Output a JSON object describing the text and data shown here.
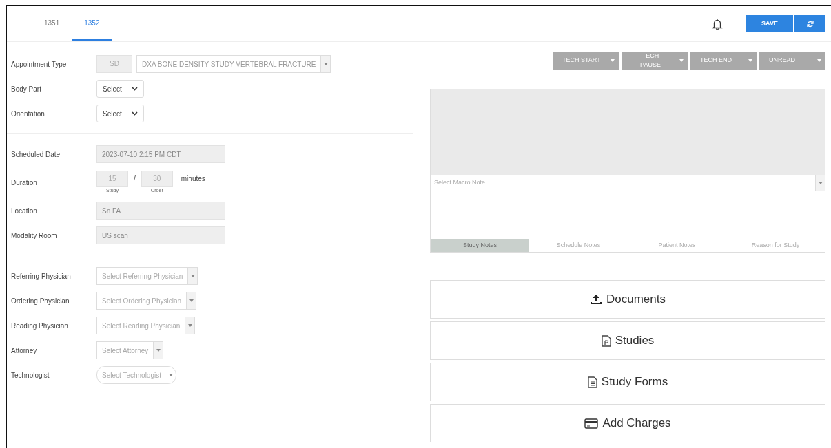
{
  "tabs": [
    {
      "label": "1351",
      "selected": false
    },
    {
      "label": "1352",
      "selected": true
    }
  ],
  "header": {
    "save_button": "SAVE"
  },
  "fields_top": [
    {
      "kind": "code_combo",
      "label": "Appointment Type",
      "code": "SD",
      "value": "DXA BONE DENSITY STUDY VERTEBRAL FRACTURE"
    },
    {
      "kind": "select",
      "label": "Body Part",
      "value": "Select"
    },
    {
      "kind": "select",
      "label": "Orientation",
      "value": "Select"
    }
  ],
  "fields_schedule": [
    {
      "kind": "text",
      "label": "Scheduled Date",
      "value": "2023-07-10 2:15 PM CDT"
    },
    {
      "kind": "duration",
      "label": "Duration",
      "study": "15",
      "study_caption": "Study",
      "separator": "/",
      "order": "30",
      "order_caption": "Order",
      "unit": "minutes"
    },
    {
      "kind": "text",
      "label": "Location",
      "value": "Sn FA"
    },
    {
      "kind": "text",
      "label": "Modality Room",
      "value": "US scan"
    }
  ],
  "fields_people": [
    {
      "kind": "combo",
      "label": "Referring Physician",
      "placeholder": "Select Referring Physician"
    },
    {
      "kind": "combo",
      "label": "Ordering Physician",
      "placeholder": "Select Ordering Physician"
    },
    {
      "kind": "combo",
      "label": "Reading Physician",
      "placeholder": "Select Reading Physician"
    },
    {
      "kind": "combo",
      "label": "Attorney",
      "placeholder": "Select Attorney"
    },
    {
      "kind": "pill",
      "label": "Technologist",
      "placeholder": "Select Technologist"
    }
  ],
  "status_buttons": [
    "TECH START",
    "TECH PAUSE",
    "TECH END",
    "UNREAD"
  ],
  "notes": {
    "macro_placeholder": "Select Macro Note",
    "tabs": [
      {
        "label": "Study Notes",
        "selected": true
      },
      {
        "label": "Schedule Notes",
        "selected": false
      },
      {
        "label": "Patient Notes",
        "selected": false
      },
      {
        "label": "Reason for Study",
        "selected": false
      }
    ]
  },
  "actions": [
    {
      "kind": "upload",
      "label": "Documents"
    },
    {
      "kind": "file",
      "label": "Studies"
    },
    {
      "kind": "form",
      "label": "Study Forms"
    },
    {
      "kind": "card",
      "label": "Add Charges"
    }
  ]
}
